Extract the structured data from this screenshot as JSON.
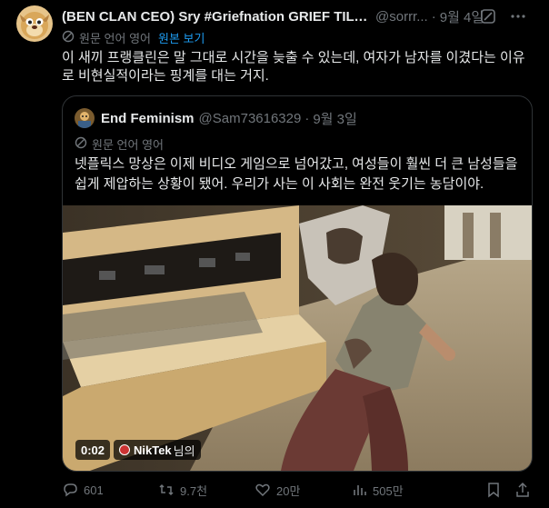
{
  "post": {
    "display_name": "(BEN CLAN CEO) Sry #Griefnation GRIEF TIL I ...",
    "handle": "@sorrr...",
    "separator": "·",
    "date": "9월 4일",
    "translate_label": "원문 언어 영어",
    "show_original": "원본 보기",
    "text": "이 새끼 프랭클린은 말 그대로 시간을 늦출 수 있는데, 여자가 남자를 이겼다는 이유로 비현실적이라는 핑계를 대는 거지."
  },
  "quote": {
    "display_name": "End Feminism",
    "handle": "@Sam73616329",
    "separator": "·",
    "date": "9월 3일",
    "translate_label": "원문 언어 영어",
    "text": "넷플릭스 망상은 이제 비디오 게임으로 넘어갔고, 여성들이 훨씬 더 큰 남성들을 쉽게 제압하는 상황이 됐어. 우리가 사는 이 사회는 완전 웃기는 농담이야.",
    "video": {
      "time": "0:02",
      "credit_name": "NikTek",
      "credit_suffix": "님의"
    }
  },
  "actions": {
    "replies": "601",
    "reposts": "9.7천",
    "likes": "20만",
    "views": "505만"
  },
  "colors": {
    "background": "#000000",
    "text": "#e7e9ea",
    "muted": "#71767b",
    "accent": "#1d9bf0",
    "border": "#2f3336"
  },
  "icons": [
    "dog-avatar",
    "grok-icon",
    "more-icon",
    "translate-icon",
    "reply-icon",
    "repost-icon",
    "like-icon",
    "views-icon",
    "bookmark-icon",
    "share-icon"
  ]
}
